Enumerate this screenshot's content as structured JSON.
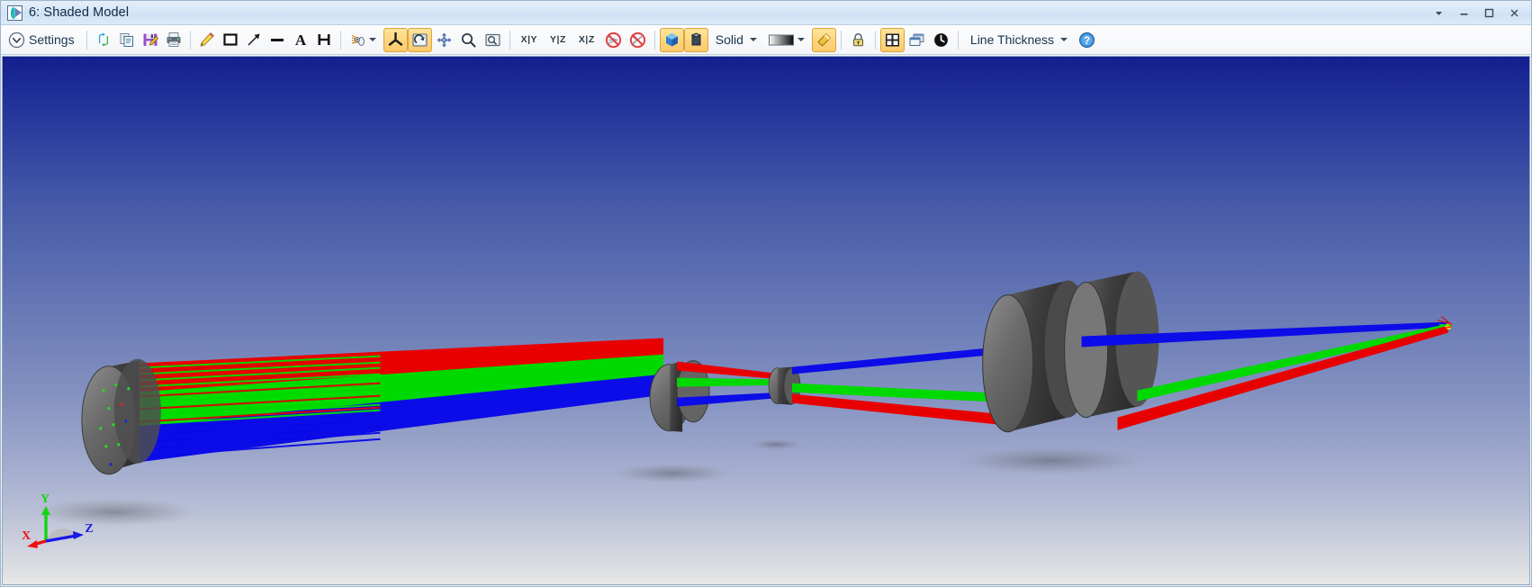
{
  "window": {
    "title": "6: Shaded Model",
    "icon": "shaded-model-icon",
    "controls": [
      {
        "name": "dropdown-arrow-button",
        "glyph": "▼"
      },
      {
        "name": "minimize-button",
        "glyph": "–"
      },
      {
        "name": "maximize-button",
        "glyph": "□"
      },
      {
        "name": "close-button",
        "glyph": "✕"
      }
    ]
  },
  "toolbar": {
    "settings_label": "Settings",
    "solid_label": "Solid",
    "line_thickness_label": "Line Thickness",
    "axis_buttons": [
      "X|Y",
      "Y|Z",
      "X|Z"
    ],
    "items": [
      {
        "name": "settings-button",
        "label": "Settings",
        "pressed": false
      },
      {
        "name": "refresh-button",
        "label": "",
        "pressed": false
      },
      {
        "name": "copy-button",
        "label": "",
        "pressed": false
      },
      {
        "name": "save-button",
        "label": "",
        "pressed": false
      },
      {
        "name": "print-button",
        "label": "",
        "pressed": false
      },
      {
        "name": "annotate-pencil-button",
        "label": "",
        "pressed": false
      },
      {
        "name": "rectangle-tool-button",
        "label": "",
        "pressed": false
      },
      {
        "name": "arrow-tool-button",
        "label": "",
        "pressed": false
      },
      {
        "name": "line-tool-button",
        "label": "",
        "pressed": false
      },
      {
        "name": "text-tool-button",
        "label": "",
        "pressed": false
      },
      {
        "name": "dimension-tool-button",
        "label": "",
        "pressed": false
      },
      {
        "name": "rays-dropdown-button",
        "label": "",
        "pressed": false
      },
      {
        "name": "tripod-rotate-button",
        "label": "",
        "pressed": true
      },
      {
        "name": "rotate-view-button",
        "label": "",
        "pressed": true
      },
      {
        "name": "pan-button",
        "label": "",
        "pressed": false
      },
      {
        "name": "zoom-button",
        "label": "",
        "pressed": false
      },
      {
        "name": "zoom-window-button",
        "label": "",
        "pressed": false
      },
      {
        "name": "view-xy-button",
        "label": "X|Y",
        "pressed": false
      },
      {
        "name": "view-yz-button",
        "label": "Y|Z",
        "pressed": false
      },
      {
        "name": "view-xz-button",
        "label": "X|Z",
        "pressed": false
      },
      {
        "name": "hide-rays-button",
        "label": "",
        "pressed": false
      },
      {
        "name": "hide-lenses-button",
        "label": "",
        "pressed": false
      },
      {
        "name": "shaded-model-button",
        "label": "",
        "pressed": true
      },
      {
        "name": "solid-mode-button",
        "label": "",
        "pressed": true
      },
      {
        "name": "render-mode-dropdown",
        "label": "Solid",
        "pressed": false
      },
      {
        "name": "gradient-dropdown",
        "label": "",
        "pressed": false
      },
      {
        "name": "flashlight-button",
        "label": "",
        "pressed": true
      },
      {
        "name": "lock-button",
        "label": "",
        "pressed": false
      },
      {
        "name": "fit-window-button",
        "label": "",
        "pressed": true
      },
      {
        "name": "tile-windows-button",
        "label": "",
        "pressed": false
      },
      {
        "name": "reset-view-button",
        "label": "",
        "pressed": false
      },
      {
        "name": "line-thickness-dropdown",
        "label": "Line Thickness",
        "pressed": false
      },
      {
        "name": "help-button",
        "label": "",
        "pressed": false
      }
    ]
  },
  "viewport": {
    "background_top_color": "#151f8e",
    "background_bottom_color": "#e9e8e5",
    "triad": {
      "x_label": "X",
      "y_label": "Y",
      "z_label": "Z",
      "x_color": "#ee1111",
      "y_color": "#12d412",
      "z_color": "#1818e8"
    },
    "ray_colors": {
      "red": "#ee0000",
      "green": "#00e400",
      "blue": "#0808ee"
    },
    "element_color": "#585858",
    "scene_description": "Shaded 3D model of an optical system with collimated ray bundle entering a large lens at left, passing through two mid-path lens groups, then two large lens elements at right converging to focus"
  }
}
